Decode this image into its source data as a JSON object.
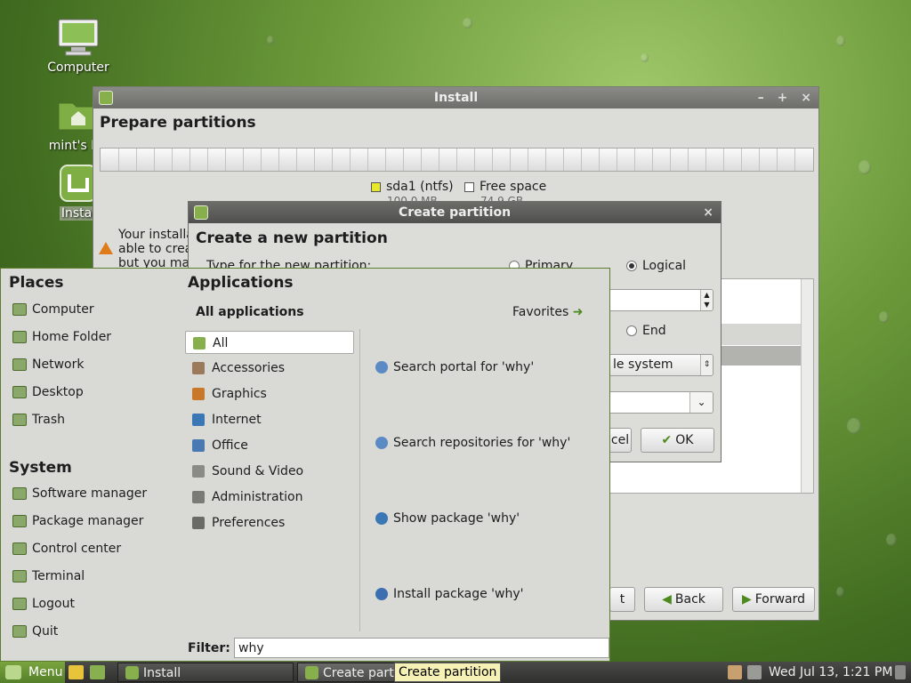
{
  "desktop": {
    "icons": [
      {
        "label": "Computer",
        "icon": "computer-icon"
      },
      {
        "label": "mint's Ho",
        "icon": "home-folder-icon"
      },
      {
        "label": "Instal",
        "icon": "install-icon"
      }
    ]
  },
  "install_window": {
    "title": "Install",
    "controls": [
      "–",
      "+",
      "×"
    ],
    "heading": "Prepare partitions",
    "legend": [
      {
        "name": "sda1 (ntfs)",
        "size": "100.0 MB",
        "color": "#e8e82a"
      },
      {
        "name": "Free space",
        "size": "74.9 GB",
        "color": "#ffffff"
      }
    ],
    "warning_lines": [
      "Your installa",
      "able to crea",
      "but you may"
    ],
    "buttons": {
      "quit": "t",
      "back": "Back",
      "forward": "Forward"
    }
  },
  "dialog": {
    "title": "Create partition",
    "close": "×",
    "heading": "Create a new partition",
    "type_label": "Type for the new partition:",
    "type_options": {
      "primary": "Primary",
      "logical": "Logical",
      "selected": "logical"
    },
    "location_end": "End",
    "use_as_value": "le system",
    "cancel_label": "cel",
    "ok_label": "OK"
  },
  "menu": {
    "places_title": "Places",
    "places": [
      {
        "label": "Computer",
        "icon": "computer-icon"
      },
      {
        "label": "Home Folder",
        "icon": "home-folder-icon"
      },
      {
        "label": "Network",
        "icon": "network-icon"
      },
      {
        "label": "Desktop",
        "icon": "desktop-icon"
      },
      {
        "label": "Trash",
        "icon": "trash-icon"
      }
    ],
    "system_title": "System",
    "system": [
      {
        "label": "Software manager",
        "icon": "software-manager-icon"
      },
      {
        "label": "Package manager",
        "icon": "package-manager-icon"
      },
      {
        "label": "Control center",
        "icon": "control-center-icon"
      },
      {
        "label": "Terminal",
        "icon": "terminal-icon"
      },
      {
        "label": "Logout",
        "icon": "logout-icon"
      },
      {
        "label": "Quit",
        "icon": "quit-icon"
      }
    ],
    "applications_title": "Applications",
    "all_applications": "All applications",
    "favorites": "Favorites",
    "categories": [
      {
        "label": "All",
        "color": "#87b04c"
      },
      {
        "label": "Accessories",
        "color": "#9a7a5a"
      },
      {
        "label": "Graphics",
        "color": "#c8782a"
      },
      {
        "label": "Internet",
        "color": "#3b77b5"
      },
      {
        "label": "Office",
        "color": "#4a78b0"
      },
      {
        "label": "Sound & Video",
        "color": "#8a8a86"
      },
      {
        "label": "Administration",
        "color": "#7a7a76"
      },
      {
        "label": "Preferences",
        "color": "#6a6a66"
      }
    ],
    "results": [
      {
        "label": "Search portal for 'why'",
        "icon": "search-icon"
      },
      {
        "label": "Search repositories for 'why'",
        "icon": "search-icon"
      },
      {
        "label": "Show package 'why'",
        "icon": "info-icon"
      },
      {
        "label": "Install package 'why'",
        "icon": "plus-icon"
      }
    ],
    "filter_label": "Filter:",
    "filter_value": "why"
  },
  "panel": {
    "menu_label": "Menu",
    "tasks": [
      {
        "label": "Install"
      },
      {
        "label": "Create parti"
      }
    ],
    "tooltip": "Create partition",
    "clock": "Wed Jul 13,  1:21 PM"
  }
}
